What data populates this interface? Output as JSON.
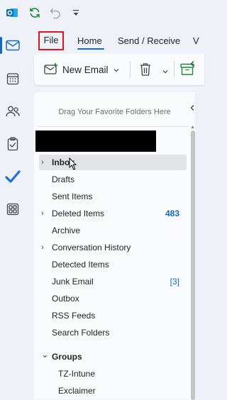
{
  "quick_access": {
    "icons": [
      "outlook-logo-icon",
      "sync-icon",
      "undo-icon",
      "customize-toolbar-icon"
    ]
  },
  "rail": {
    "items": [
      {
        "name": "mail",
        "icon": "mail-icon",
        "selected": true
      },
      {
        "name": "calendar",
        "icon": "calendar-icon"
      },
      {
        "name": "people",
        "icon": "people-icon"
      },
      {
        "name": "tasks",
        "icon": "clipboard-icon"
      },
      {
        "name": "todo",
        "icon": "checkmark-icon"
      },
      {
        "name": "apps",
        "icon": "apps-icon"
      }
    ]
  },
  "ribbon": {
    "tabs": {
      "file": "File",
      "home": "Home",
      "send_receive": "Send / Receive",
      "more": "V"
    },
    "new_email_label": "New Email"
  },
  "folder_pane": {
    "favorites_hint": "Drag Your Favorite Folders Here",
    "folders": [
      {
        "label": "Inbox",
        "chevron": "›",
        "count": "",
        "selected": true
      },
      {
        "label": "Drafts",
        "chevron": "",
        "count": ""
      },
      {
        "label": "Sent Items",
        "chevron": "",
        "count": ""
      },
      {
        "label": "Deleted Items",
        "chevron": "›",
        "count": "483"
      },
      {
        "label": "Archive",
        "chevron": "",
        "count": ""
      },
      {
        "label": "Conversation History",
        "chevron": "›",
        "count": ""
      },
      {
        "label": "Detected Items",
        "chevron": "",
        "count": ""
      },
      {
        "label": "Junk Email",
        "chevron": "",
        "count": "[3]"
      },
      {
        "label": "Outbox",
        "chevron": "",
        "count": ""
      },
      {
        "label": "RSS Feeds",
        "chevron": "",
        "count": ""
      },
      {
        "label": "Search Folders",
        "chevron": "",
        "count": ""
      }
    ],
    "groups_label": "Groups",
    "groups_chevron": "⌄",
    "groups": [
      {
        "label": "TZ-Intune"
      },
      {
        "label": "Exclaimer"
      }
    ]
  },
  "colors": {
    "accent": "#0f6cbd",
    "file_highlight": "#e0141e",
    "sync_green": "#1f8a3a"
  }
}
